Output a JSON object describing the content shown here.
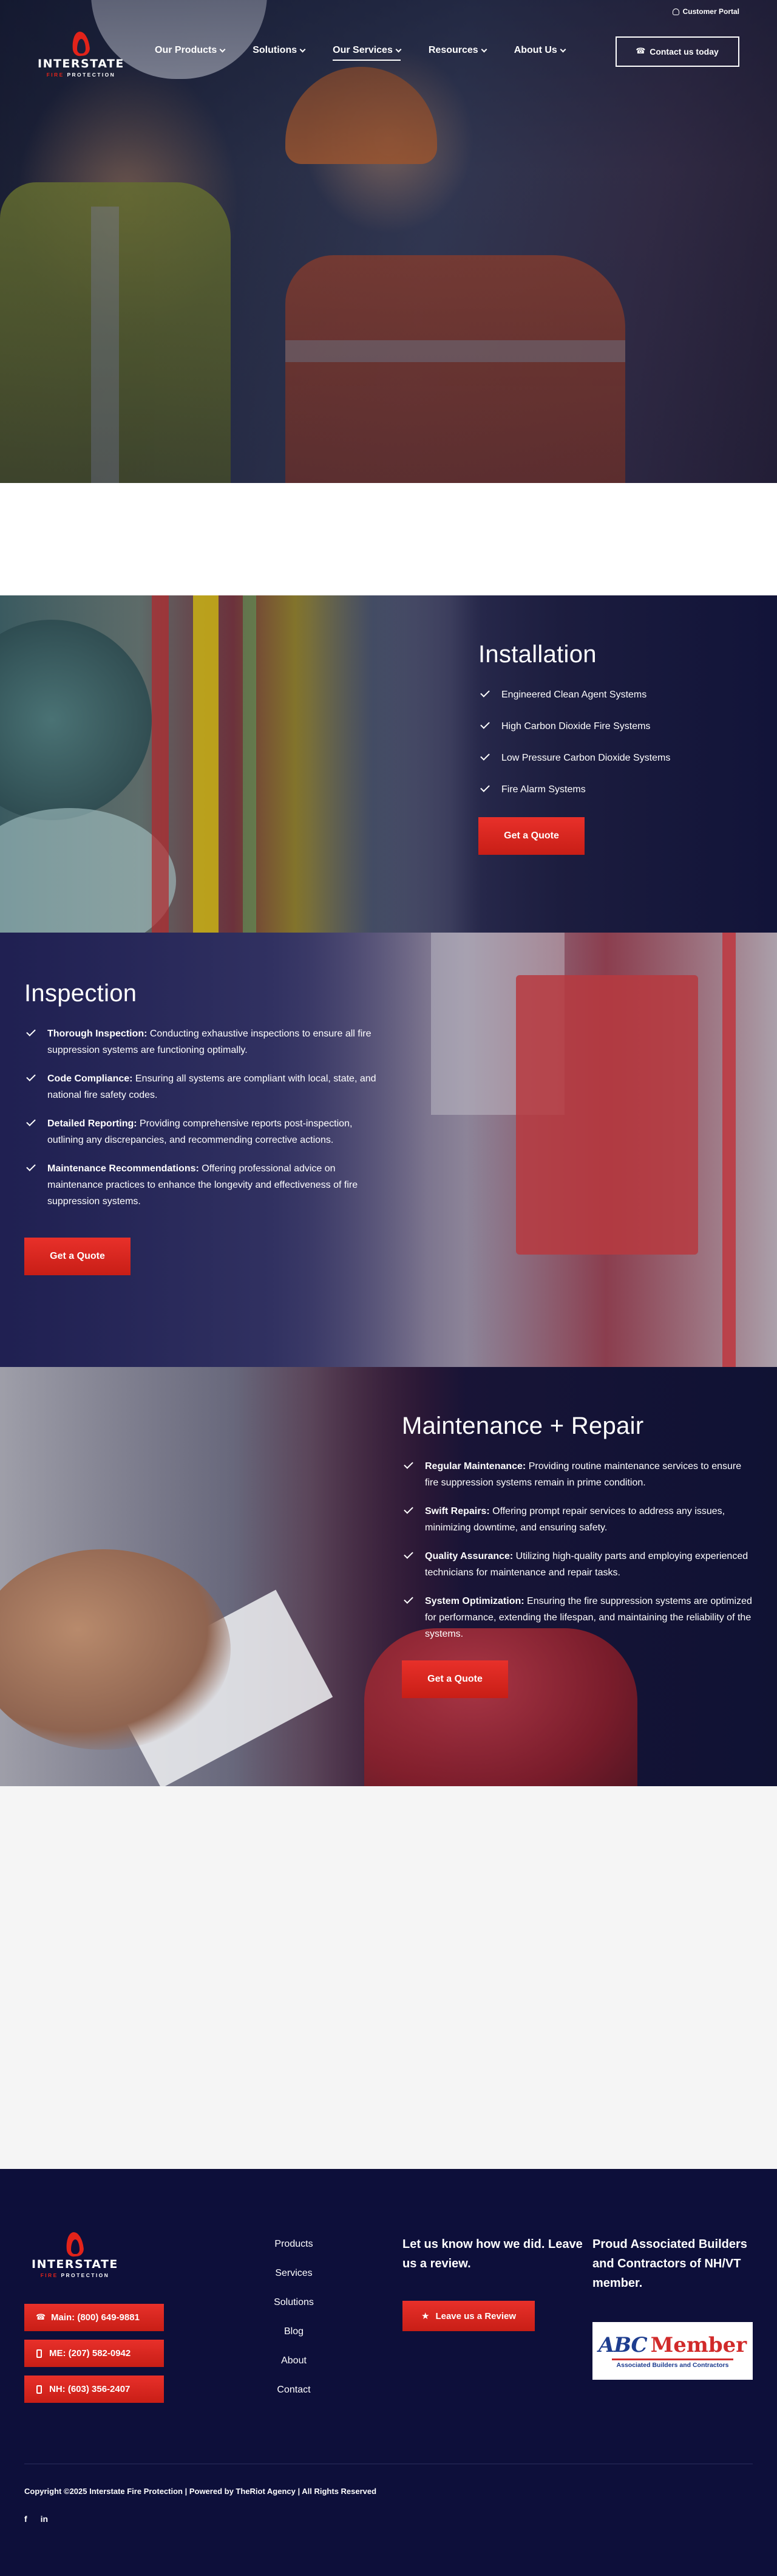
{
  "topbar": {
    "customer_portal": "Customer Portal"
  },
  "brand": {
    "name": "INTERSTATE",
    "sub_red": "FIRE",
    "sub_white": "PROTECTION"
  },
  "nav": [
    {
      "label": "Our Products"
    },
    {
      "label": "Solutions"
    },
    {
      "label": "Our Services"
    },
    {
      "label": "Resources"
    },
    {
      "label": "About Us"
    }
  ],
  "header": {
    "contact_label": "Contact us today"
  },
  "installation": {
    "title": "Installation",
    "items": [
      "Engineered Clean Agent Systems",
      "High Carbon Dioxide Fire Systems",
      "Low Pressure Carbon Dioxide Systems",
      "Fire Alarm Systems"
    ],
    "cta": "Get a Quote"
  },
  "inspection": {
    "title": "Inspection",
    "items": [
      {
        "bold": "Thorough Inspection:",
        "text": " Conducting exhaustive inspections to ensure all fire suppression systems are functioning optimally."
      },
      {
        "bold": "Code Compliance:",
        "text": " Ensuring all systems are compliant with local, state, and national fire safety codes."
      },
      {
        "bold": "Detailed Reporting:",
        "text": " Providing comprehensive reports post-inspection, outlining any discrepancies, and recommending corrective actions."
      },
      {
        "bold": "Maintenance Recommendations:",
        "text": " Offering professional advice on maintenance practices to enhance the longevity and effectiveness of fire suppression systems."
      }
    ],
    "cta": "Get a Quote"
  },
  "maintenance": {
    "title": "Maintenance + Repair",
    "items": [
      {
        "bold": "Regular Maintenance:",
        "text": " Providing routine maintenance services to ensure fire suppression systems remain in prime condition."
      },
      {
        "bold": "Swift Repairs:",
        "text": " Offering prompt repair services to address any issues, minimizing downtime, and ensuring safety."
      },
      {
        "bold": "Quality Assurance:",
        "text": " Utilizing high-quality parts and employing experienced technicians for maintenance and repair tasks."
      },
      {
        "bold": "System Optimization:",
        "text": " Ensuring the fire suppression systems are optimized for performance, extending the lifespan, and maintaining the reliability of the systems."
      }
    ],
    "cta": "Get a Quote"
  },
  "footer": {
    "phones": [
      "Main: (800) 649-9881",
      "ME: (207) 582-0942",
      "NH: (603) 356-2407"
    ],
    "links": [
      "Products",
      "Services",
      "Solutions",
      "Blog",
      "About",
      "Contact"
    ],
    "review_title": "Let us know how we did. Leave us a review.",
    "review_btn": "Leave us a Review",
    "proud": "Proud Associated Builders and Contractors of NH/VT member.",
    "abc_logo": {
      "abc": "ABC",
      "member": "Member",
      "tagline": "Associated Builders and Contractors"
    },
    "copyright": "Copyright ©2025 Interstate Fire Protection | Powered by TheRiot Agency | All Rights Reserved",
    "social": {
      "facebook": "f",
      "linkedin": "in"
    }
  },
  "colors": {
    "accent_red": "#e2231a",
    "navy": "#0d0f3a",
    "light_grey": "#f5f5f5"
  },
  "icons": {
    "user": "user-icon",
    "phone": "phone-icon",
    "mobile": "mobile-icon",
    "check": "check-icon",
    "star": "star-icon",
    "chevron": "chevron-down-icon"
  }
}
